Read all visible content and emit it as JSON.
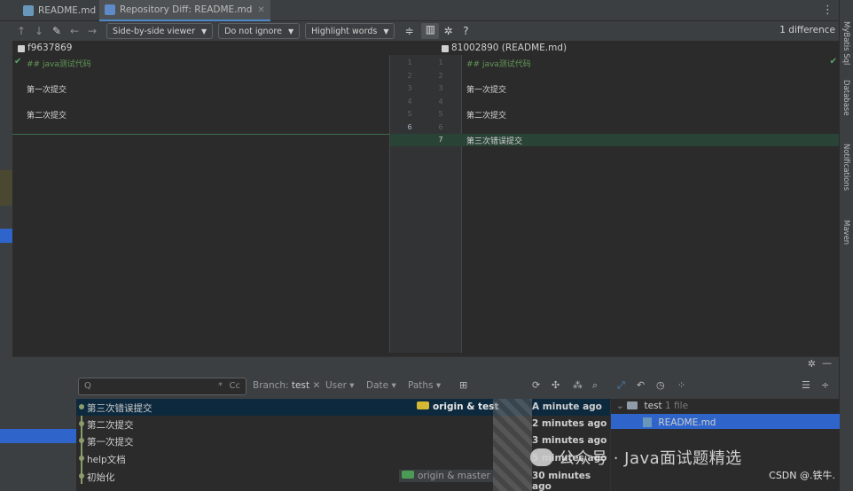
{
  "tabs": [
    {
      "label": "README.md",
      "active": false
    },
    {
      "label": "Repository Diff: README.md",
      "active": true
    }
  ],
  "toolbar": {
    "viewer": "Side-by-side viewer",
    "ignore": "Do not ignore",
    "highlight": "Highlight words",
    "help": "?",
    "diff_count": "1 difference"
  },
  "left_revision": "f9637869",
  "right_revision": "81002890 (README.md)",
  "left_lines": [
    {
      "num": "1",
      "text": "## java测试代码"
    },
    {
      "num": "2",
      "text": ""
    },
    {
      "num": "3",
      "text": "第一次提交"
    },
    {
      "num": "4",
      "text": ""
    },
    {
      "num": "5",
      "text": "第二次提交"
    },
    {
      "num": "6",
      "text": ""
    }
  ],
  "right_lines": [
    {
      "num": "1",
      "text": "## java测试代码"
    },
    {
      "num": "2",
      "text": ""
    },
    {
      "num": "3",
      "text": "第一次提交"
    },
    {
      "num": "4",
      "text": ""
    },
    {
      "num": "5",
      "text": "第二次提交"
    },
    {
      "num": "6",
      "text": ""
    },
    {
      "num": "7",
      "text": "第三次错误提交"
    }
  ],
  "right_strip": [
    "MyBatis Sql",
    "Database",
    "Notifications",
    "Maven"
  ],
  "log": {
    "search_placeholder": "Q",
    "regex": "*",
    "case": "Cc",
    "branch_label": "Branch:",
    "branch_value": "test",
    "user": "User",
    "date": "Date",
    "paths": "Paths"
  },
  "commits": [
    {
      "msg": "第三次错误提交",
      "ref": "origin & test",
      "time": "A minute ago",
      "selected": true
    },
    {
      "msg": "第二次提交",
      "ref": "",
      "time": "2 minutes ago",
      "selected": false
    },
    {
      "msg": "第一次提交",
      "ref": "",
      "time": "3 minutes ago",
      "selected": false
    },
    {
      "msg": "help文档",
      "ref": "",
      "time": "5 minutes ago",
      "selected": false
    },
    {
      "msg": "初始化",
      "ref": "origin & master",
      "time": "30 minutes ago",
      "selected": false
    }
  ],
  "files": {
    "folder": "test",
    "folder_count": "1 file",
    "file": "README.md"
  },
  "watermark": "公众号 · Java面试题精选",
  "credit": "CSDN @.铁牛.",
  "colors": {
    "accent": "#2f65ca",
    "added_bg": "#294436",
    "ref_tag_yellow": "#d5b833",
    "ref_tag_green": "#4a9c54"
  }
}
